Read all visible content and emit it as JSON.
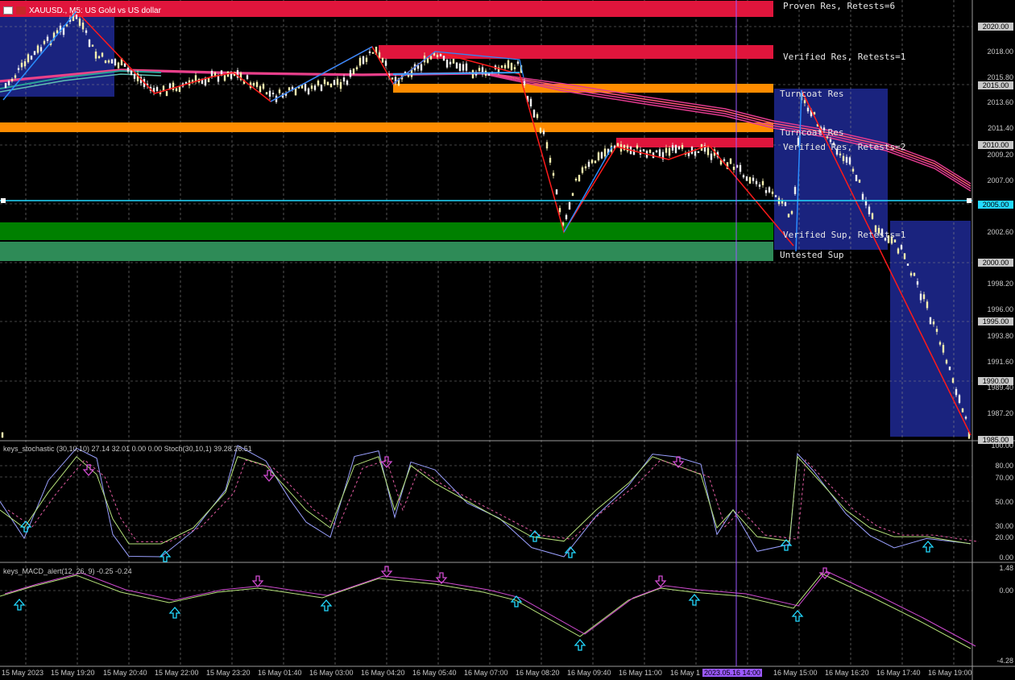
{
  "window": {
    "symbol_title": "XAUUSD., M5:  US Gold vs US dollar"
  },
  "zones": {
    "proven_res": "Proven Res, Retests=6",
    "verified_res_1": "Verified Res, Retests=1",
    "turncoat_res_1": "Turncoat Res",
    "turncoat_res_2": "Turncoat Res",
    "verified_res_2": "Verified Res, Retests=2",
    "verified_sup": "Verified Sup, Retests=1",
    "untested_sup": "Untested Sup"
  },
  "price_axis": {
    "labels": [
      "2018.00",
      "2015.80",
      "2013.60",
      "2011.40",
      "2009.20",
      "2007.00",
      "2002.60",
      "1998.20",
      "1996.00",
      "1993.80",
      "1991.60",
      "1989.40",
      "1987.20"
    ],
    "tags": [
      "2020.00",
      "2015.00",
      "2010.00",
      "2005.00",
      "2000.00",
      "1995.00",
      "1990.00",
      "1985.00"
    ],
    "current_price": "2005.00"
  },
  "stochastic": {
    "title": "keys_stochastic (30,10,10) 27.14 32.01 0.00 0.00 Stoch(30,10,1) 39.28 26.51",
    "levels": [
      "100.00",
      "80.00",
      "70.00",
      "50.00",
      "30.00",
      "20.00",
      "0.00"
    ]
  },
  "macd": {
    "title": "keys_MACD_alert(12, 26, 9) -0.25 -0.24",
    "levels": [
      "1.48",
      "0.00",
      "-4.28"
    ]
  },
  "time_axis": {
    "labels": [
      "15 May 2023",
      "15 May 19:20",
      "15 May 20:40",
      "15 May 22:00",
      "15 May 23:20",
      "16 May 01:40",
      "16 May 03:00",
      "16 May 04:20",
      "16 May 05:40",
      "16 May 07:00",
      "16 May 08:20",
      "16 May 09:40",
      "16 May 11:00",
      "16 May 1",
      "2023.05.16 14:00",
      "16 May 15:00",
      "16 May 16:20",
      "16 May 17:40",
      "16 May 19:00"
    ]
  },
  "colors": {
    "background": "#000000",
    "grid": "#8a8a8a",
    "resistance_red": "#e0153c",
    "turncoat_orange": "#ff8c00",
    "support_green": "#008000",
    "untested_green": "#2e8b57",
    "box_blue": "#1a237e",
    "cyan_line": "#23d9ff",
    "zigzag_red": "#ff1a1a",
    "zigzag_blue": "#2a8cff",
    "candle_white": "#f0f0f0",
    "candle_yellow": "#f5f0b0",
    "ma_pink": "#e23b8f",
    "ma_teal": "#2aa198",
    "stoch_main": "#9aa0ff",
    "stoch_signal": "#b6e27a",
    "macd_main": "#b6e27a",
    "macd_signal": "#d04bd0",
    "arrow_up": "#23d9ff",
    "arrow_down": "#d04bd0",
    "time_marker": "#9b59ff"
  }
}
